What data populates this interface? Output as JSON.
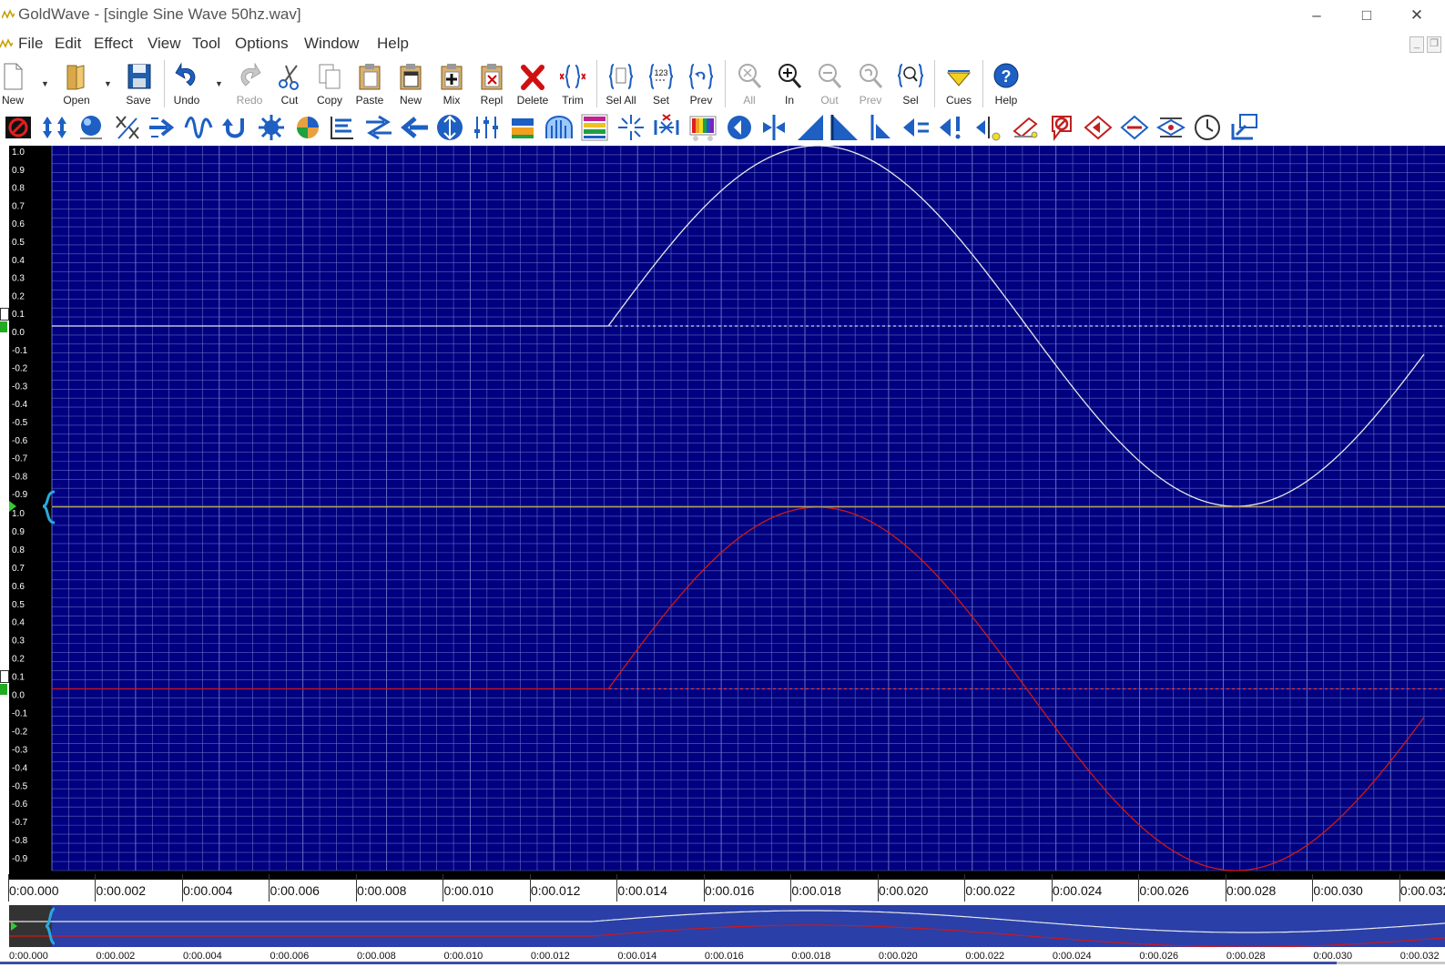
{
  "window": {
    "title": "GoldWave - [single Sine Wave 50hz.wav]"
  },
  "menu": [
    "File",
    "Edit",
    "Effect",
    "View",
    "Tool",
    "Options",
    "Window",
    "Help"
  ],
  "toolbar": [
    {
      "id": "new",
      "label": "New",
      "icon": "new-file-icon"
    },
    {
      "id": "open",
      "label": "Open",
      "icon": "open-folder-icon"
    },
    {
      "id": "save",
      "label": "Save",
      "icon": "save-disk-icon"
    },
    {
      "id": "undo",
      "label": "Undo",
      "icon": "undo-icon"
    },
    {
      "id": "redo",
      "label": "Redo",
      "icon": "redo-icon",
      "disabled": true
    },
    {
      "id": "cut",
      "label": "Cut",
      "icon": "scissors-icon"
    },
    {
      "id": "copy",
      "label": "Copy",
      "icon": "copy-icon"
    },
    {
      "id": "paste",
      "label": "Paste",
      "icon": "paste-icon"
    },
    {
      "id": "pastenew",
      "label": "New",
      "icon": "paste-new-icon"
    },
    {
      "id": "mix",
      "label": "Mix",
      "icon": "mix-icon"
    },
    {
      "id": "repl",
      "label": "Repl",
      "icon": "replace-icon"
    },
    {
      "id": "delete",
      "label": "Delete",
      "icon": "delete-x-icon"
    },
    {
      "id": "trim",
      "label": "Trim",
      "icon": "trim-icon"
    },
    {
      "id": "selall",
      "label": "Sel All",
      "icon": "select-all-icon"
    },
    {
      "id": "set",
      "label": "Set",
      "icon": "set-selection-icon"
    },
    {
      "id": "prev",
      "label": "Prev",
      "icon": "previous-selection-icon"
    },
    {
      "id": "zoomall",
      "label": "All",
      "icon": "zoom-all-icon",
      "disabled": true
    },
    {
      "id": "zoomin",
      "label": "In",
      "icon": "zoom-in-icon"
    },
    {
      "id": "zoomout",
      "label": "Out",
      "icon": "zoom-out-icon",
      "disabled": true
    },
    {
      "id": "zoomprev",
      "label": "Prev",
      "icon": "zoom-previous-icon",
      "disabled": true
    },
    {
      "id": "zoomsel",
      "label": "Sel",
      "icon": "zoom-selection-icon"
    },
    {
      "id": "cues",
      "label": "Cues",
      "icon": "cue-triangle-icon"
    },
    {
      "id": "help",
      "label": "Help",
      "icon": "help-icon"
    }
  ],
  "effects_icons": [
    "stop-effect-icon",
    "maximize-volume-icon",
    "sphere-icon",
    "channel-swap-icon",
    "arrow-right-icon",
    "wave-icon",
    "loop-icon",
    "gear-blue-icon",
    "reverse-icon",
    "equalizer-icon",
    "stretch-icon",
    "arrow-left-icon",
    "resize-vertical-icon",
    "mixer-sliders-icon",
    "fade-icon",
    "arch-icon",
    "spectrum-icon",
    "sparkle-icon",
    "compress-icon",
    "color-bars-icon",
    "speaker-icon",
    "cursor-split-icon",
    "fade-in-icon",
    "fade-out-icon",
    "mark-left-icon",
    "volume-down-icon",
    "volume-up-icon",
    "speaker-cursor-icon",
    "pen-edit-icon",
    "no-entry-icon",
    "marker-red-icon",
    "marker-blue-icon",
    "marker-both-icon",
    "clock-icon",
    "monitor-down-icon"
  ],
  "colors": {
    "wave_bg": "#000080",
    "grid": "#6d7ac8",
    "left_channel": "#e8e8e8",
    "right_channel": "#d01818"
  },
  "chart_data": {
    "type": "line",
    "x_unit": "seconds",
    "xlim": [
      0,
      0.0328
    ],
    "ylim": [
      -1.0,
      1.0
    ],
    "channels": [
      {
        "color": "#e8e8e8",
        "signal": "sine",
        "frequency_hz": 50,
        "amplitude": 1.0,
        "start": 0.0133,
        "end": 0.0328
      },
      {
        "color": "#d01818",
        "signal": "sine",
        "frequency_hz": 50,
        "amplitude": 1.0,
        "start": 0.0133,
        "end": 0.0328
      }
    ],
    "y_ticks": [
      "1.0",
      "0.9",
      "0.8",
      "0.7",
      "0.6",
      "0.5",
      "0.4",
      "0.3",
      "0.2",
      "0.1",
      "0.0",
      "-0.1",
      "-0.2",
      "-0.3",
      "-0.4",
      "-0.5",
      "-0.6",
      "-0.7",
      "-0.8",
      "-0.9"
    ],
    "x_ticks": [
      {
        "t": 0.0,
        "label": "0:00.000"
      },
      {
        "t": 0.002,
        "label": "0:00.002"
      },
      {
        "t": 0.004,
        "label": "0:00.004"
      },
      {
        "t": 0.006,
        "label": "0:00.006"
      },
      {
        "t": 0.008,
        "label": "0:00.008"
      },
      {
        "t": 0.01,
        "label": "0:00.010"
      },
      {
        "t": 0.012,
        "label": "0:00.012"
      },
      {
        "t": 0.014,
        "label": "0:00.014"
      },
      {
        "t": 0.016,
        "label": "0:00.016"
      },
      {
        "t": 0.018,
        "label": "0:00.018"
      },
      {
        "t": 0.02,
        "label": "0:00.020"
      },
      {
        "t": 0.022,
        "label": "0:00.022"
      },
      {
        "t": 0.024,
        "label": "0:00.024"
      },
      {
        "t": 0.026,
        "label": "0:00.026"
      },
      {
        "t": 0.028,
        "label": "0:00.028"
      },
      {
        "t": 0.03,
        "label": "0:00.030"
      },
      {
        "t": 0.032,
        "label": "0:00.032"
      }
    ]
  }
}
